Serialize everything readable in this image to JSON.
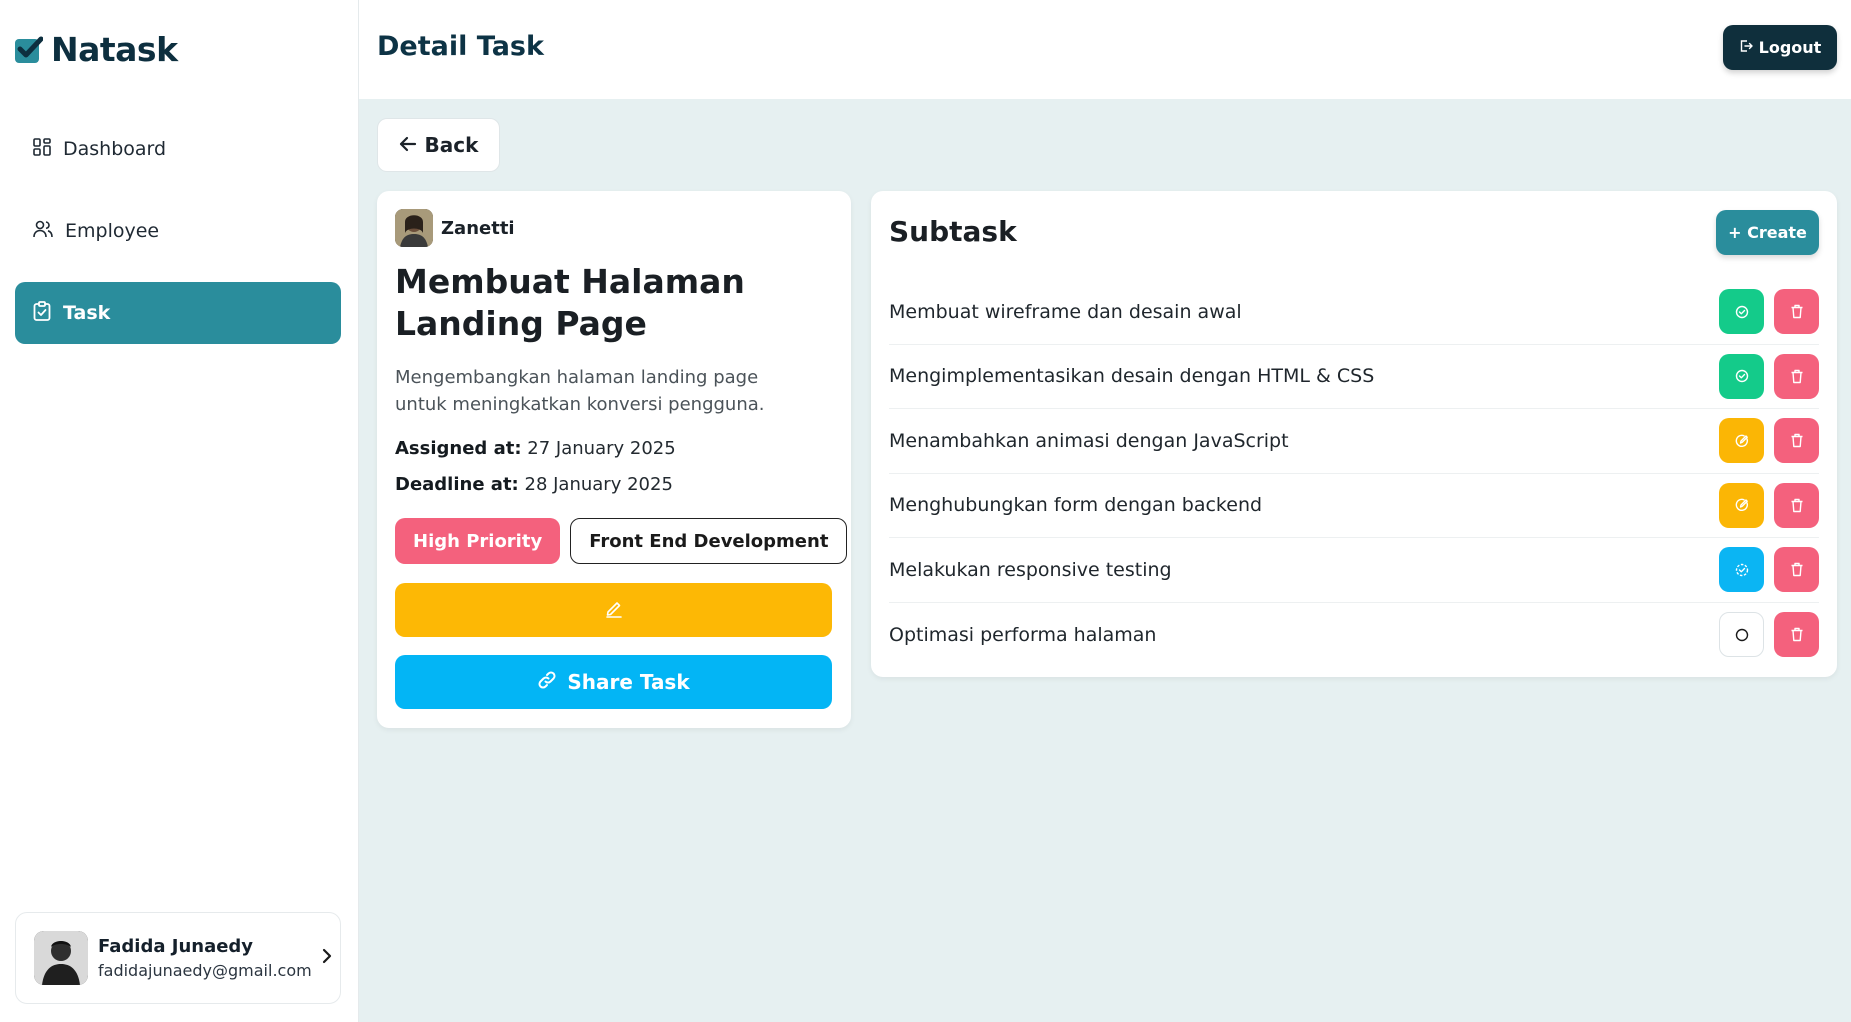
{
  "app": {
    "name": "Natask"
  },
  "sidebar": {
    "items": [
      {
        "label": "Dashboard",
        "icon": "dashboard-icon",
        "active": false
      },
      {
        "label": "Employee",
        "icon": "users-icon",
        "active": false
      },
      {
        "label": "Task",
        "icon": "clipboard-check-icon",
        "active": true
      }
    ],
    "user": {
      "name": "Fadida Junaedy",
      "email": "fadidajunaedy@gmail.com"
    }
  },
  "header": {
    "title": "Detail Task",
    "logout_label": "Logout"
  },
  "back_label": "Back",
  "task": {
    "assignee": "Zanetti",
    "title": "Membuat Halaman Landing Page",
    "description": "Mengembangkan halaman landing page untuk meningkatkan konversi pengguna.",
    "assigned_label": "Assigned at:",
    "assigned_value": "27 January 2025",
    "deadline_label": "Deadline at:",
    "deadline_value": "28 January 2025",
    "priority_tag": "High Priority",
    "category_tag": "Front End Development",
    "share_label": "Share Task"
  },
  "subtask": {
    "title": "Subtask",
    "create_label": "+ Create",
    "items": [
      {
        "label": "Membuat wireframe dan desain awal",
        "status": "done"
      },
      {
        "label": "Mengimplementasikan desain dengan HTML & CSS",
        "status": "done"
      },
      {
        "label": "Menambahkan animasi dengan JavaScript",
        "status": "in-progress"
      },
      {
        "label": "Menghubungkan form dengan backend",
        "status": "in-progress"
      },
      {
        "label": "Melakukan responsive testing",
        "status": "review"
      },
      {
        "label": "Optimasi performa halaman",
        "status": "todo"
      }
    ]
  },
  "colors": {
    "primary": "#2a8d9c",
    "dark": "#0f2f3c",
    "done": "#14cb8a",
    "in_progress": "#fbb605",
    "review": "#0bb5f3",
    "danger": "#f4617d",
    "share": "#03b5f5",
    "background": "#e6f0f1"
  }
}
